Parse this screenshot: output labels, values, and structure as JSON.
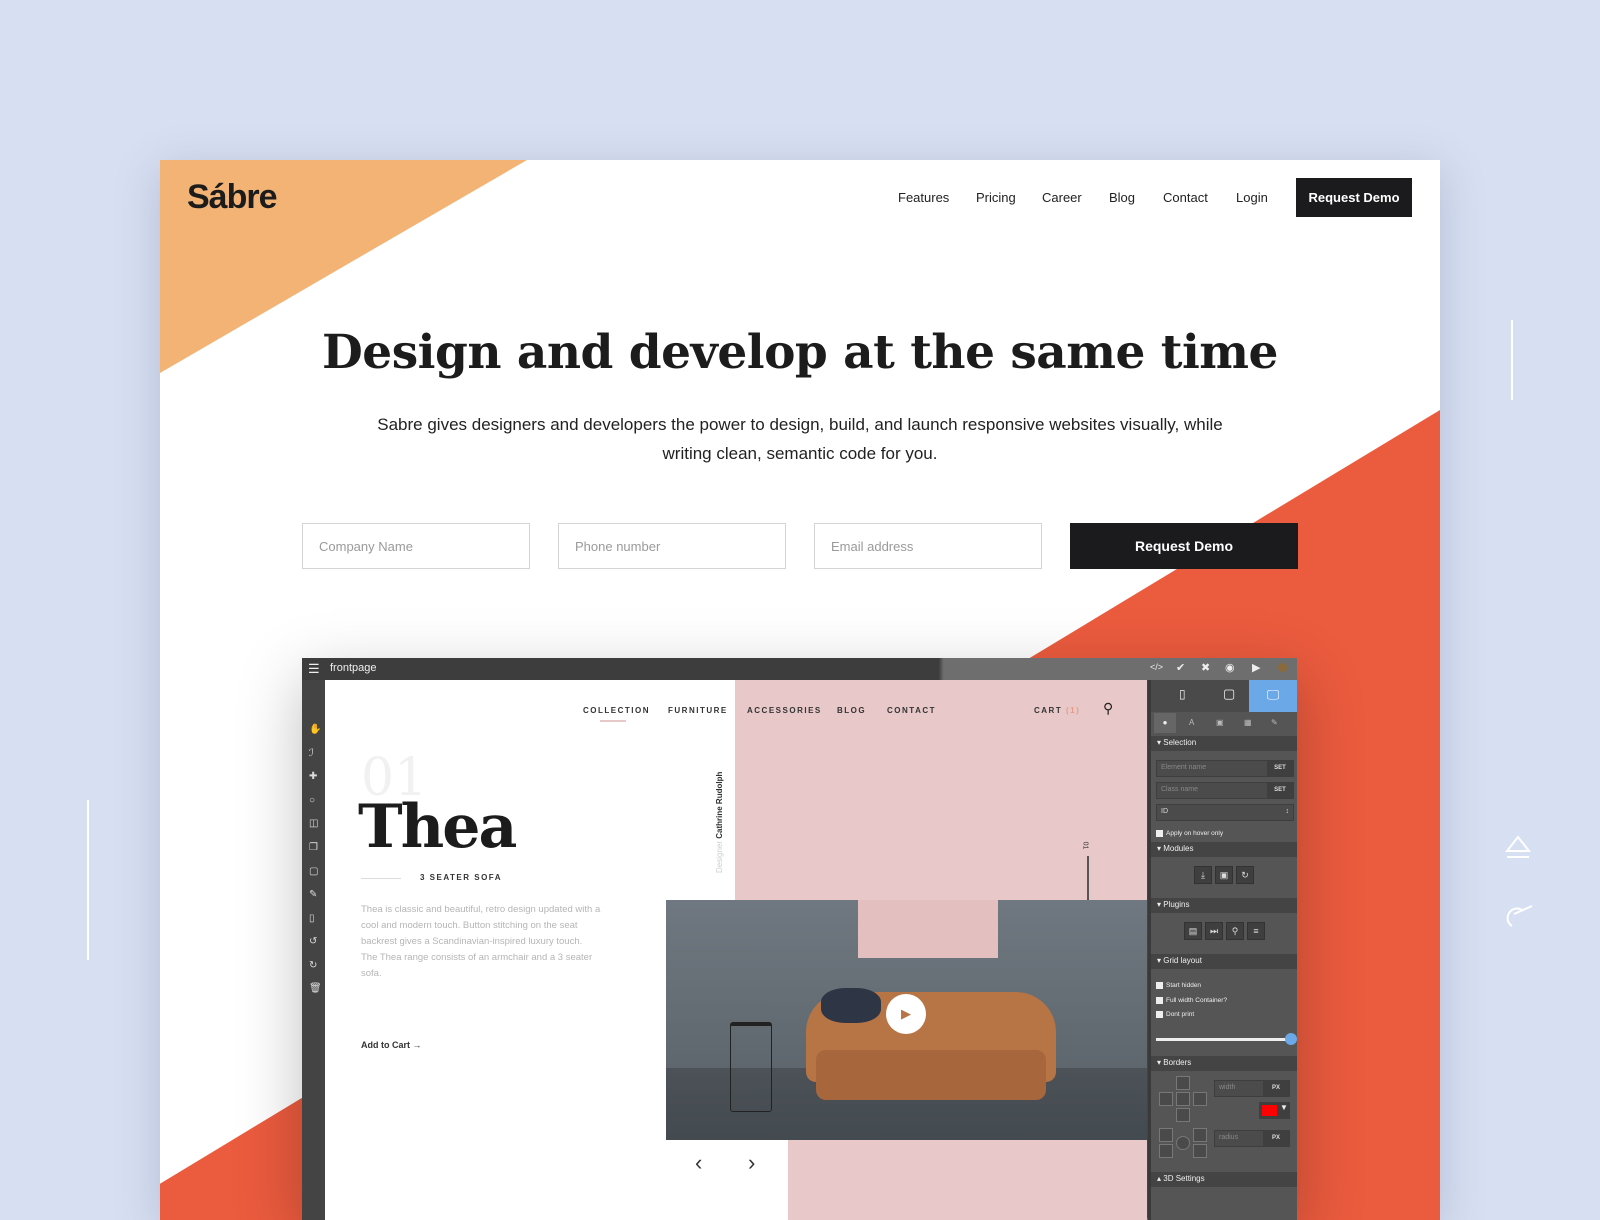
{
  "colors": {
    "background": "#d7dff2",
    "orange": "#f3b374",
    "red": "#eb5b3e",
    "dark": "#1b1b1d",
    "pink": "#e8c8c9",
    "panel_active": "#6aa8e8"
  },
  "brand": {
    "logo": "Sábre"
  },
  "nav": {
    "items": [
      "Features",
      "Pricing",
      "Career",
      "Blog",
      "Contact",
      "Login"
    ],
    "cta": "Request Demo"
  },
  "hero": {
    "title": "Design and develop at the same time",
    "subtitle": "Sabre gives designers and developers the power to design, build, and launch responsive websites visually, while writing clean, semantic code for you."
  },
  "form": {
    "company_placeholder": "Company Name",
    "phone_placeholder": "Phone number",
    "email_placeholder": "Email address",
    "submit": "Request Demo"
  },
  "editor": {
    "page_name": "frontpage",
    "toolbar_icons": [
      "code-icon",
      "check-icon",
      "close-icon",
      "eye-icon",
      "play-icon"
    ],
    "site": {
      "nav": [
        "COLLECTION",
        "FURNITURE",
        "ACCESSORIES",
        "BLOG",
        "CONTACT"
      ],
      "cart": "CART",
      "cart_count": "(1)",
      "number": "01",
      "product": "Thea",
      "subtitle": "3 SEATER SOFA",
      "designer_label": "Designer",
      "designer": "Cathrine Rudolph",
      "description": "Thea is classic and beautiful, retro design updated with a cool and modern touch. Button stitching on the seat backrest gives a Scandinavian-inspired luxury touch. The Thea range consists of an armchair and a 3 seater sofa.",
      "add_to_cart": "Add to Cart →",
      "slide_current": "01",
      "slide_total": "03",
      "prev": "‹",
      "next": "›"
    },
    "panel": {
      "selection": "▾ Selection",
      "element_name": "Element name",
      "class_name": "Class name",
      "set": "SET",
      "id": "ID",
      "hover_only": "Apply on hover only",
      "modules": "▾ Modules",
      "plugins": "▾ Plugins",
      "grid": "▾ Grid layout",
      "start_hidden": "Start hidden",
      "full_width": "Full width Container?",
      "dont_print": "Dont print",
      "slider_value": 1.0,
      "borders": "▾ Borders",
      "width": "width",
      "radius": "radius",
      "unit": "PX",
      "border_color": "#ff0000",
      "settings3d": "▴ 3D Settings"
    }
  }
}
